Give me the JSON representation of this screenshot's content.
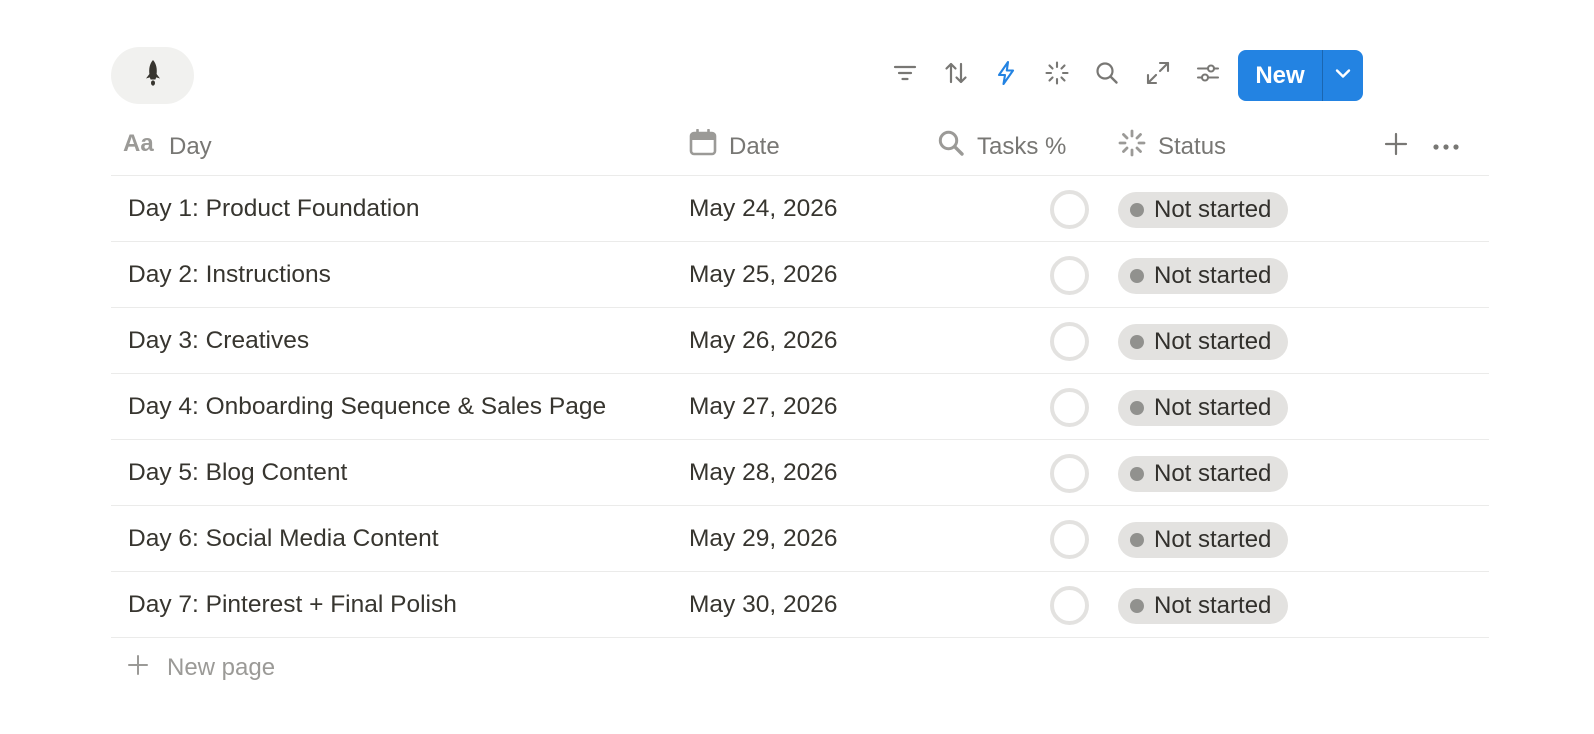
{
  "view": {
    "icon": "rocket-icon"
  },
  "toolbar": {
    "icons": [
      "filter-icon",
      "sort-icon",
      "automation-icon",
      "ai-sparkle-icon",
      "search-icon",
      "expand-icon",
      "settings-sliders-icon"
    ],
    "new_label": "New",
    "accent": "#2383e2",
    "automation_color": "#2383e2"
  },
  "columns": {
    "day": {
      "label": "Day",
      "icon": "text-property-icon"
    },
    "date": {
      "label": "Date",
      "icon": "calendar-icon"
    },
    "tasks": {
      "label": "Tasks %",
      "icon": "search-icon"
    },
    "status": {
      "label": "Status",
      "icon": "status-icon"
    }
  },
  "rows": [
    {
      "day": "Day 1: Product Foundation",
      "date": "May 24, 2026",
      "status": "Not started"
    },
    {
      "day": "Day 2: Instructions",
      "date": "May 25, 2026",
      "status": "Not started"
    },
    {
      "day": "Day 3: Creatives",
      "date": "May 26, 2026",
      "status": "Not started"
    },
    {
      "day": "Day 4: Onboarding Sequence & Sales Page",
      "date": "May 27, 2026",
      "status": "Not started"
    },
    {
      "day": "Day 5: Blog Content",
      "date": "May 28, 2026",
      "status": "Not started"
    },
    {
      "day": "Day 6: Social Media Content",
      "date": "May 29, 2026",
      "status": "Not started"
    },
    {
      "day": "Day 7: Pinterest + Final Polish",
      "date": "May 30, 2026",
      "status": "Not started"
    }
  ],
  "new_page_label": "New page",
  "status_colors": {
    "badge_bg": "#e3e2e0",
    "dot": "#91918e"
  }
}
